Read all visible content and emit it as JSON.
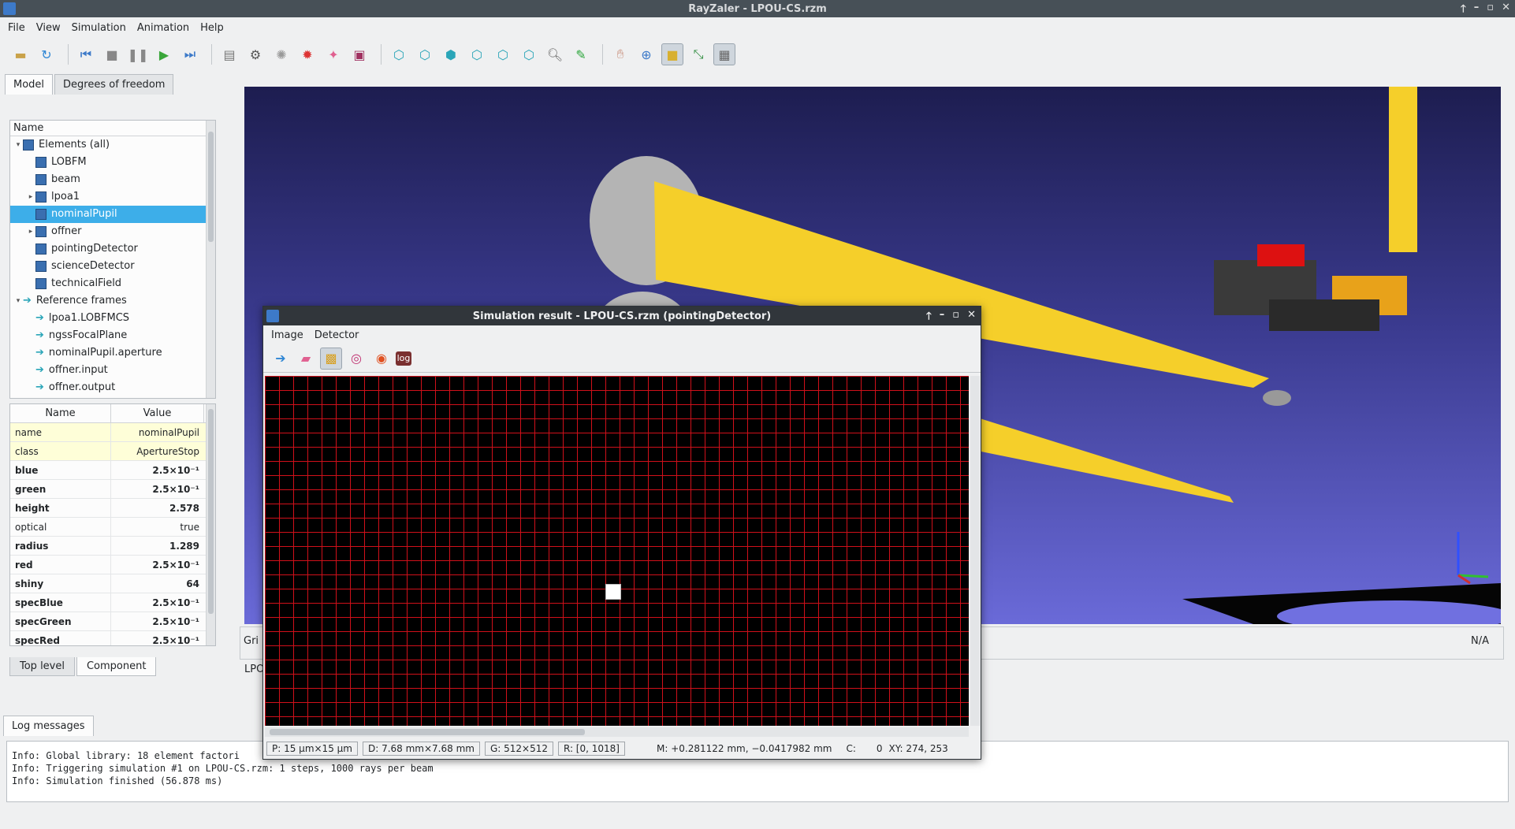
{
  "window": {
    "title": "RayZaler - LPOU-CS.rzm",
    "buttons": [
      "🡑",
      "–",
      "▫",
      "✕"
    ]
  },
  "menu": [
    "File",
    "View",
    "Simulation",
    "Animation",
    "Help"
  ],
  "left": {
    "tabs": [
      "Model",
      "Degrees of freedom"
    ],
    "tree_header": "Name",
    "tree": [
      {
        "label": "Elements (all)",
        "indent": 0,
        "arrow": "▾",
        "icon": "cube"
      },
      {
        "label": "LOBFM",
        "indent": 1,
        "arrow": "",
        "icon": "cube"
      },
      {
        "label": "beam",
        "indent": 1,
        "arrow": "",
        "icon": "cube"
      },
      {
        "label": "lpoa1",
        "indent": 1,
        "arrow": "▸",
        "icon": "cube"
      },
      {
        "label": "nominalPupil",
        "indent": 1,
        "arrow": "",
        "icon": "cube",
        "selected": true
      },
      {
        "label": "offner",
        "indent": 1,
        "arrow": "▸",
        "icon": "cube"
      },
      {
        "label": "pointingDetector",
        "indent": 1,
        "arrow": "",
        "icon": "cube"
      },
      {
        "label": "scienceDetector",
        "indent": 1,
        "arrow": "",
        "icon": "cube"
      },
      {
        "label": "technicalField",
        "indent": 1,
        "arrow": "",
        "icon": "cube"
      },
      {
        "label": "Reference frames",
        "indent": 0,
        "arrow": "▾",
        "icon": "frame"
      },
      {
        "label": "lpoa1.LOBFMCS",
        "indent": 1,
        "arrow": "",
        "icon": "frame"
      },
      {
        "label": "ngssFocalPlane",
        "indent": 1,
        "arrow": "",
        "icon": "frame"
      },
      {
        "label": "nominalPupil.aperture",
        "indent": 1,
        "arrow": "",
        "icon": "frame"
      },
      {
        "label": "offner.input",
        "indent": 1,
        "arrow": "",
        "icon": "frame"
      },
      {
        "label": "offner.output",
        "indent": 1,
        "arrow": "",
        "icon": "frame"
      }
    ],
    "props_header": {
      "name": "Name",
      "value": "Value"
    },
    "props": [
      {
        "name": "name",
        "value": "nominalPupil",
        "hl": true
      },
      {
        "name": "class",
        "value": "ApertureStop",
        "hl": true
      },
      {
        "name": "blue",
        "value": "2.5×10⁻¹",
        "bold": true
      },
      {
        "name": "green",
        "value": "2.5×10⁻¹",
        "bold": true
      },
      {
        "name": "height",
        "value": "2.578",
        "bold": true
      },
      {
        "name": "optical",
        "value": "true"
      },
      {
        "name": "radius",
        "value": "1.289",
        "bold": true
      },
      {
        "name": "red",
        "value": "2.5×10⁻¹",
        "bold": true
      },
      {
        "name": "shiny",
        "value": "64",
        "bold": true
      },
      {
        "name": "specBlue",
        "value": "2.5×10⁻¹",
        "bold": true
      },
      {
        "name": "specGreen",
        "value": "2.5×10⁻¹",
        "bold": true
      },
      {
        "name": "specRed",
        "value": "2.5×10⁻¹",
        "bold": true
      }
    ],
    "bottom_tabs": [
      "Top level",
      "Component"
    ]
  },
  "view3d": {
    "status_left": "Gri",
    "status_left2": "LPO",
    "status_right": "N/A"
  },
  "log": {
    "tab": "Log messages",
    "lines": [
      "Info: Global library: 18 element factori",
      "Info: Triggering simulation #1 on LPOU-CS.rzm: 1 steps, 1000 rays per beam",
      "Info: Simulation finished (56.878 ms)"
    ]
  },
  "sim": {
    "title": "Simulation result - LPOU-CS.rzm (pointingDetector)",
    "menu": [
      "Image",
      "Detector"
    ],
    "status": {
      "pixel": "P: 15 µm×15 µm",
      "detector": "D: 7.68 mm×7.68 mm",
      "grid": "G: 512×512",
      "range": "R: [0, 1018]",
      "mouse": "M: +0.281122 mm, −0.0417982 mm",
      "counts_label": "C:",
      "counts": "0",
      "xy": "XY: 274, 253"
    },
    "tools": [
      "arrow-right-icon",
      "eraser-icon",
      "grid-icon",
      "target-icon",
      "color-wheel-icon",
      "log-icon"
    ],
    "log_btn": "log"
  }
}
